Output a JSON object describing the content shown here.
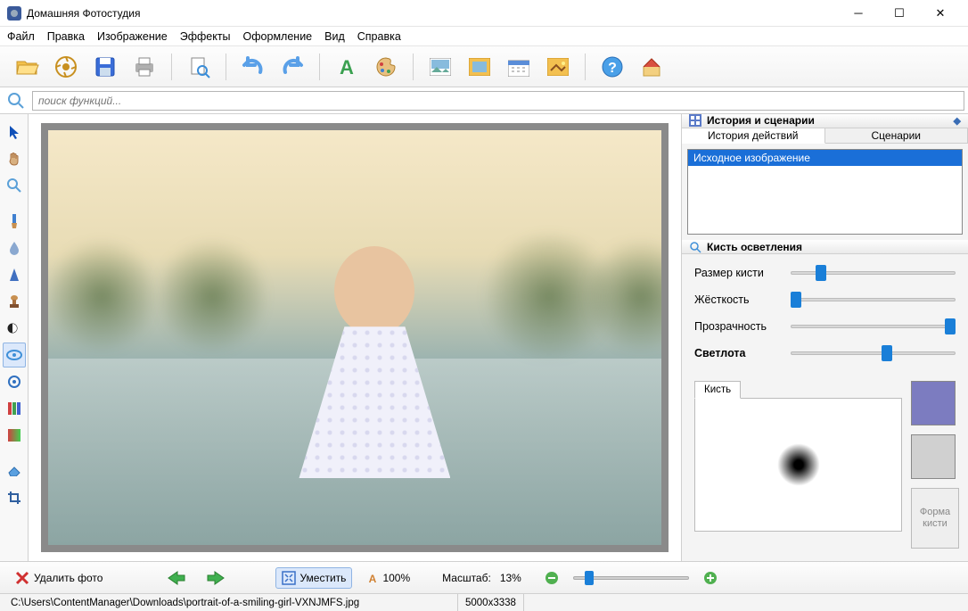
{
  "app": {
    "title": "Домашняя Фотостудия"
  },
  "menu": [
    "Файл",
    "Правка",
    "Изображение",
    "Эффекты",
    "Оформление",
    "Вид",
    "Справка"
  ],
  "search": {
    "placeholder": "поиск функций..."
  },
  "right": {
    "history_header": "История и сценарии",
    "tabs": {
      "history": "История действий",
      "scenarios": "Сценарии"
    },
    "history_item": "Исходное изображение",
    "brush_header": "Кисть осветления",
    "sliders": {
      "size": "Размер кисти",
      "hardness": "Жёсткость",
      "opacity": "Прозрачность",
      "lightness": "Светлота"
    },
    "brush_tab": "Кисть",
    "shape_btn": "Форма кисти",
    "color_swatch": "#7c7cc0"
  },
  "bottom": {
    "delete": "Удалить фото",
    "fit": "Уместить",
    "hundred": "100%",
    "scale_label": "Масштаб:",
    "scale_value": "13%"
  },
  "status": {
    "path": "C:\\Users\\ContentManager\\Downloads\\portrait-of-a-smiling-girl-VXNJMFS.jpg",
    "dims": "5000x3338"
  }
}
